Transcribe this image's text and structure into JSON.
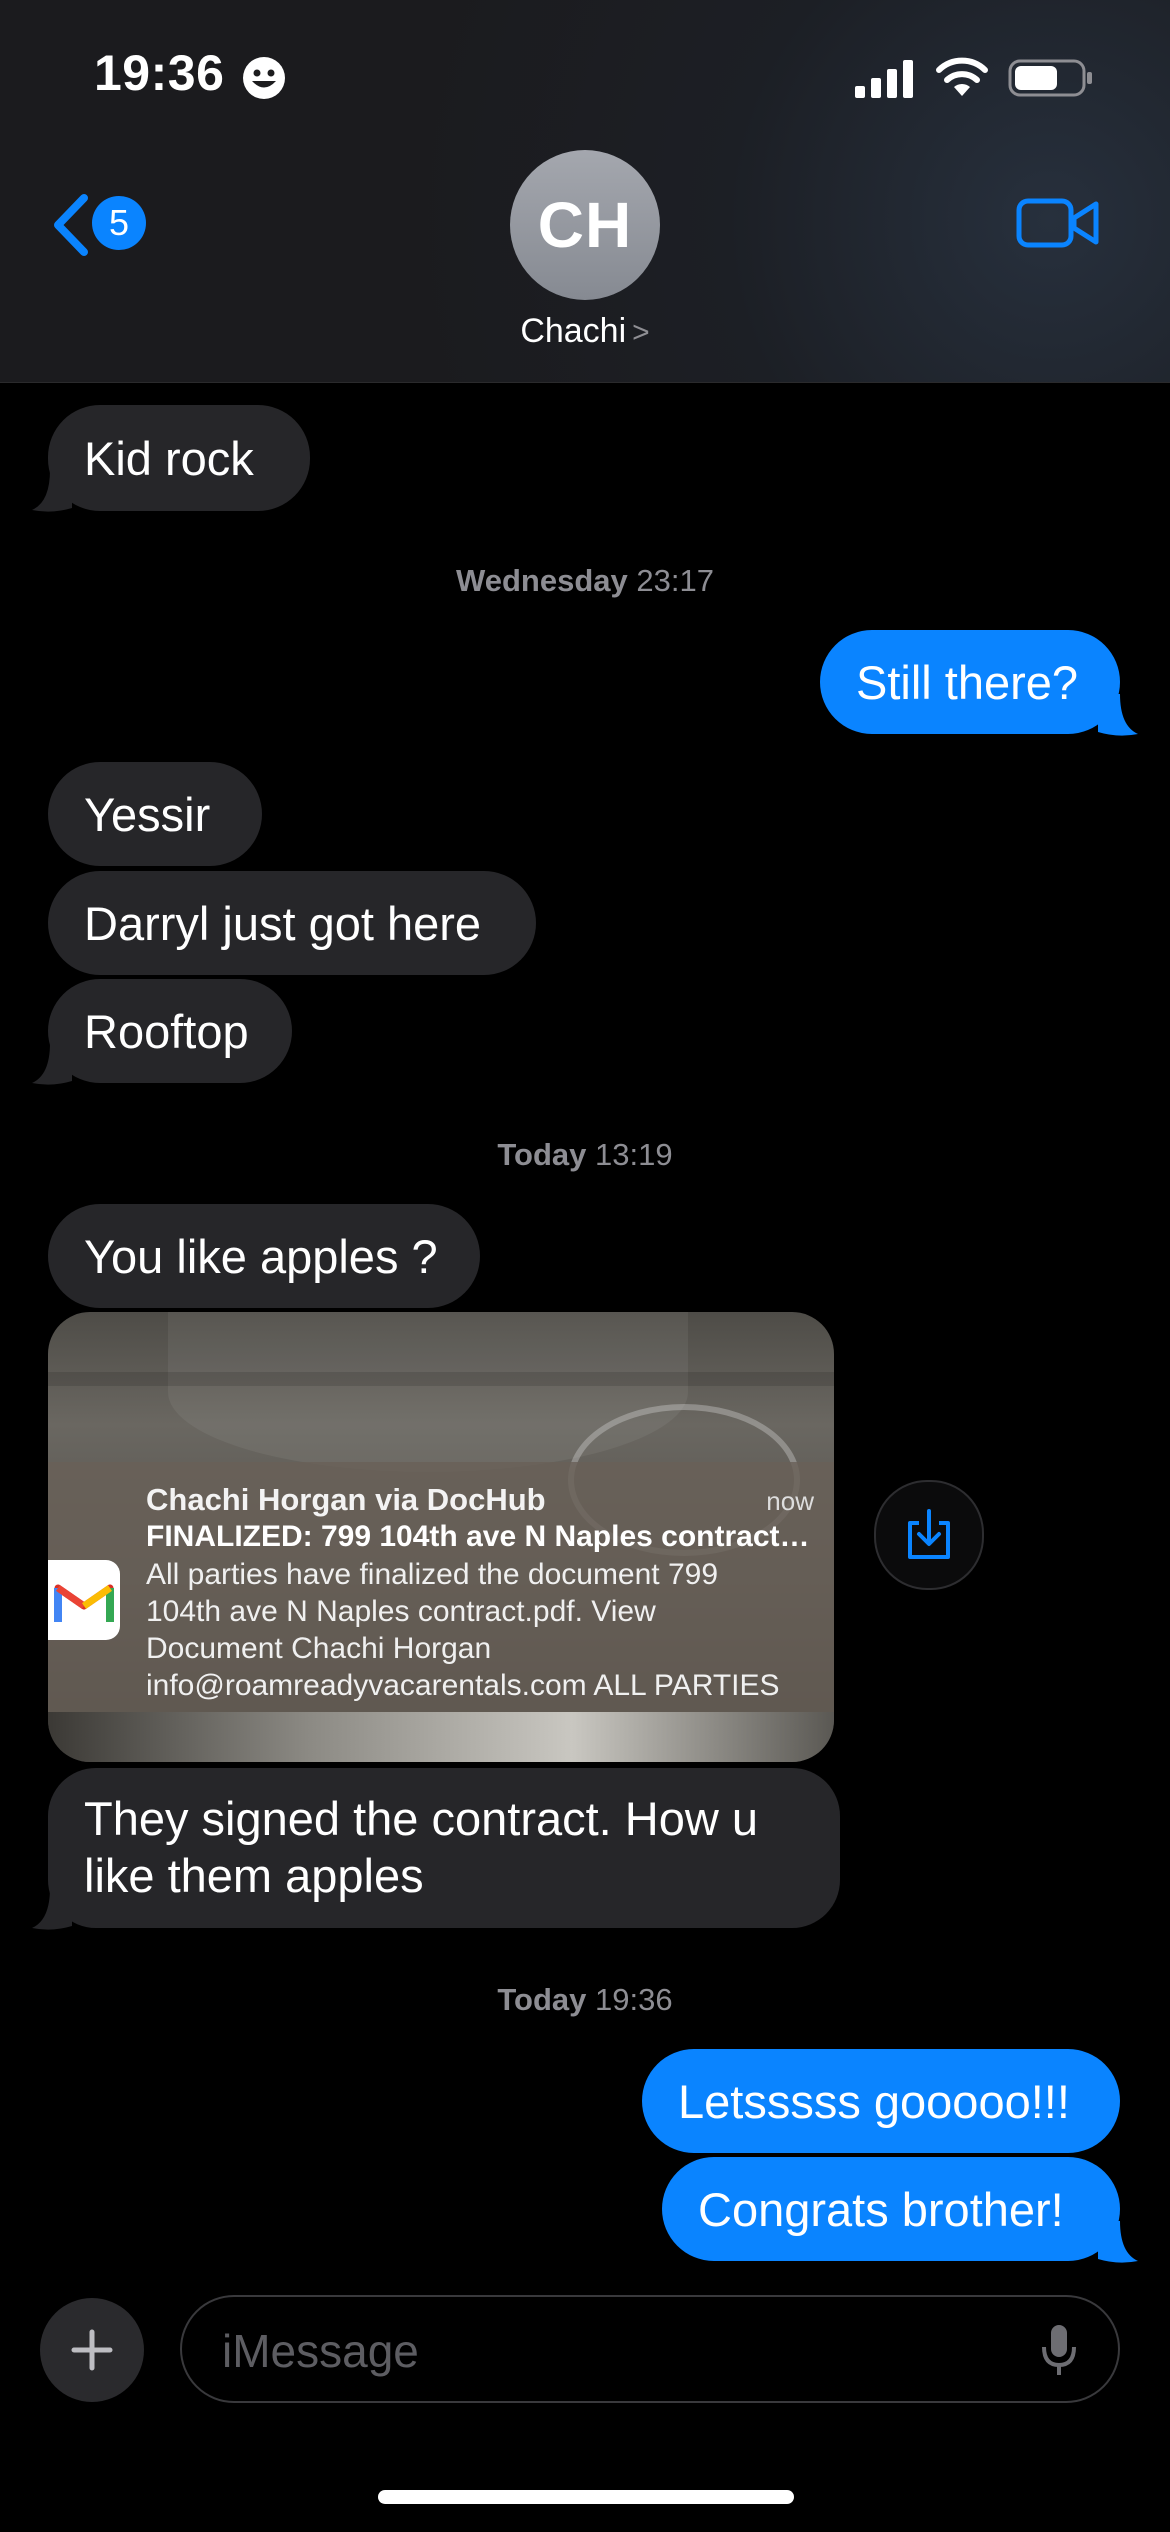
{
  "status_bar": {
    "time": "19:36"
  },
  "header": {
    "back_count": "5",
    "avatar_initials": "CH",
    "contact_name": "Chachi",
    "chevron": ">"
  },
  "messages": {
    "m1": "Kid rock",
    "ts1": {
      "day": "Wednesday",
      "time": "23:17"
    },
    "m2": "Still there?",
    "m3": "Yessir",
    "m4": "Darryl just got here",
    "m5": "Rooftop",
    "ts2": {
      "day": "Today",
      "time": "13:19"
    },
    "m6": "You like apples ?",
    "m7_line1": "They signed the contract. How u",
    "m7_line2": "like them apples",
    "ts3": {
      "day": "Today",
      "time": "19:36"
    },
    "m8": "Letsssss gooooo!!!",
    "m9": "Congrats brother!"
  },
  "image_attachment": {
    "notification": {
      "app_icon": "gmail-icon",
      "title": "Chachi Horgan via DocHub",
      "time": "now",
      "subject": "FINALIZED: 799 104th ave N Naples contract.pdf",
      "body_lines": [
        "All parties have finalized the document 799",
        "104th ave N Naples contract.pdf. View",
        "Document Chachi Horgan",
        "info@roamreadyvacarentals.com ALL PARTIES"
      ]
    }
  },
  "composer": {
    "placeholder": "iMessage"
  },
  "colors": {
    "outgoing": "#0a84ff",
    "incoming": "#262629",
    "background": "#000000"
  }
}
